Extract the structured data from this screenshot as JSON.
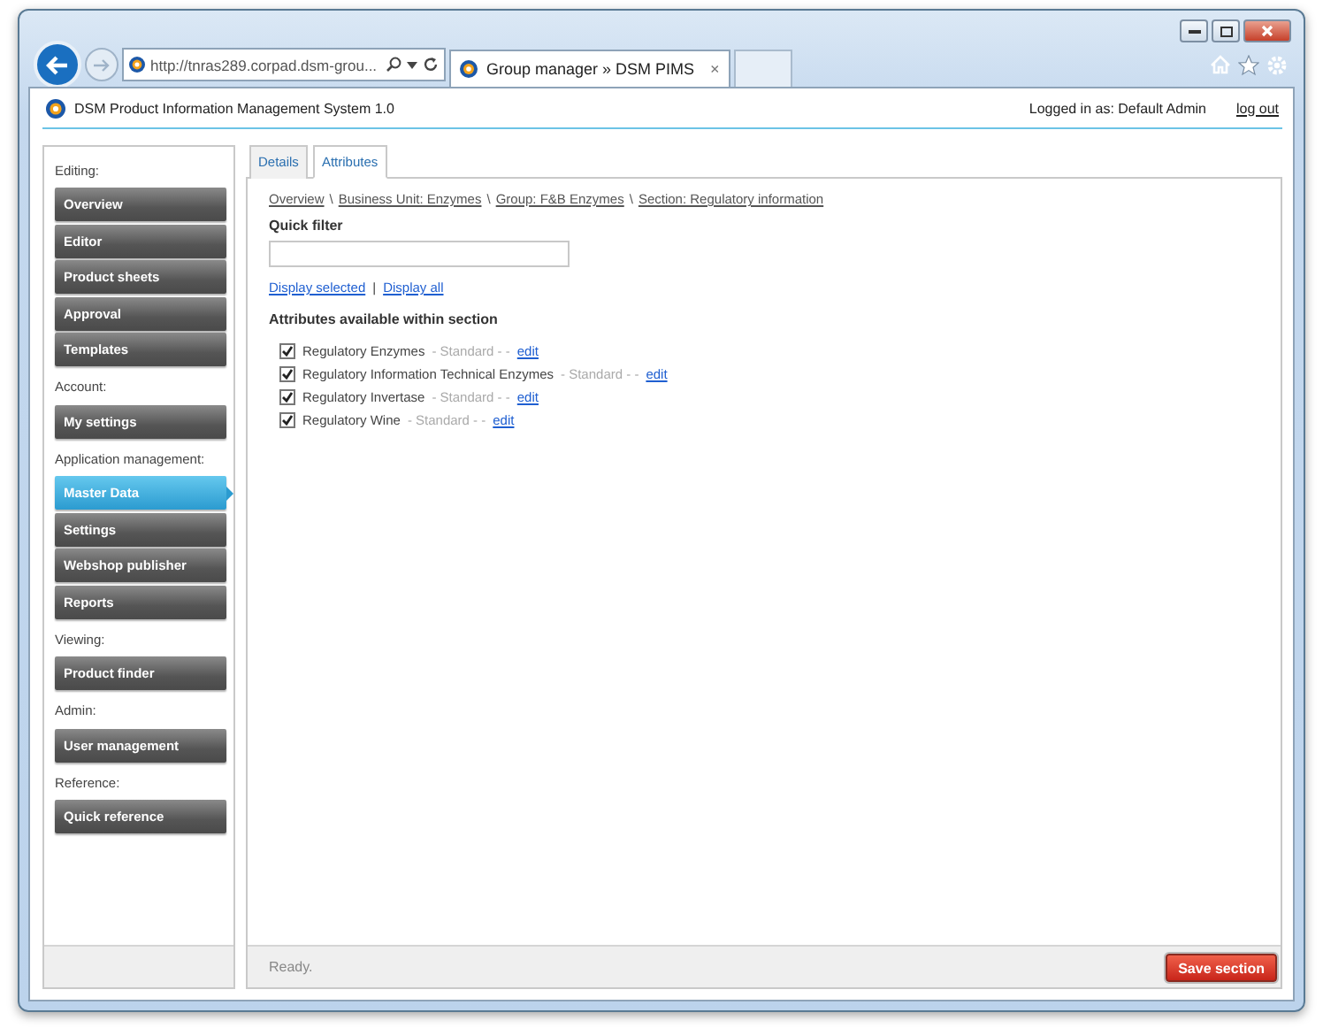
{
  "browser": {
    "address": "http://tnras289.corpad.dsm-grou...",
    "tabs": [
      {
        "label": "Group manager » DSM PIMS",
        "close": "×",
        "selected": true
      }
    ]
  },
  "header": {
    "title": "DSM Product Information Management System 1.0",
    "user": "Logged in as: Default Admin",
    "logout": "log out"
  },
  "sidebar": {
    "groups": [
      {
        "heading": "Editing:",
        "items": [
          {
            "label": "Overview",
            "selected": false
          },
          {
            "label": "Editor",
            "selected": false
          },
          {
            "label": "Product sheets",
            "selected": false
          },
          {
            "label": "Approval",
            "selected": false
          },
          {
            "label": "Templates",
            "selected": false
          }
        ]
      },
      {
        "heading": "Account:",
        "items": [
          {
            "label": "My settings",
            "selected": false
          }
        ]
      },
      {
        "heading": "Application management:",
        "items": [
          {
            "label": "Master Data",
            "selected": true
          },
          {
            "label": "Settings",
            "selected": false
          },
          {
            "label": "Webshop publisher",
            "selected": false
          },
          {
            "label": "Reports",
            "selected": false
          }
        ]
      },
      {
        "heading": "Viewing:",
        "items": [
          {
            "label": "Product finder",
            "selected": false
          }
        ]
      },
      {
        "heading": "Admin:",
        "items": [
          {
            "label": "User management",
            "selected": false
          }
        ]
      },
      {
        "heading": "Reference:",
        "items": [
          {
            "label": "Quick reference",
            "selected": false
          }
        ]
      }
    ]
  },
  "content_tabs": [
    {
      "label": "Details",
      "selected": false
    },
    {
      "label": "Attributes",
      "selected": true
    }
  ],
  "breadcrumb": [
    {
      "label": "Overview",
      "separator": "\\"
    },
    {
      "label": "Business Unit: Enzymes",
      "separator": "\\"
    },
    {
      "label": "Group: F&B Enzymes",
      "separator": "\\"
    },
    {
      "label": "Section: Regulatory information"
    }
  ],
  "quick_filter": {
    "label": "Quick filter"
  },
  "display_links": {
    "selected": "Display selected",
    "divider": "|",
    "all": "Display all"
  },
  "section_heading": "Attributes available within section",
  "attributes": [
    {
      "name": "Regulatory Enzymes",
      "detail": "- Standard - -",
      "edit": "edit",
      "checked": true
    },
    {
      "name": "Regulatory Information Technical Enzymes",
      "detail": "- Standard - -",
      "edit": "edit",
      "checked": true
    },
    {
      "name": "Regulatory Invertase",
      "detail": "- Standard - -",
      "edit": "edit",
      "checked": true
    },
    {
      "name": "Regulatory Wine",
      "detail": "- Standard - -",
      "edit": "edit",
      "checked": true
    }
  ],
  "status": "Ready.",
  "save_button": "Save section"
}
